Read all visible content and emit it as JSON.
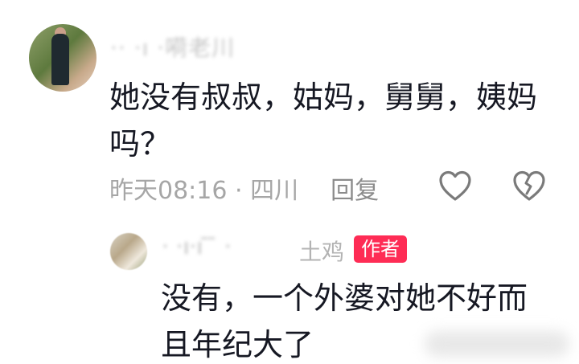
{
  "comment": {
    "username": "·· ·ı ·嗬老川",
    "text": "她没有叔叔，姑妈，舅舅，姨妈吗？",
    "meta": "昨天08:16 · 四川",
    "reply_label": "回复",
    "like_icon": "heart-outline-icon",
    "dislike_icon": "broken-heart-icon"
  },
  "reply": {
    "username": "· ·ı·ı  ̄ ̄ ·",
    "username_tail": "土鸡",
    "author_badge": "作者",
    "badge_color": "#fe2c55",
    "text": "没有，一个外婆对她不好而且年纪大了"
  }
}
